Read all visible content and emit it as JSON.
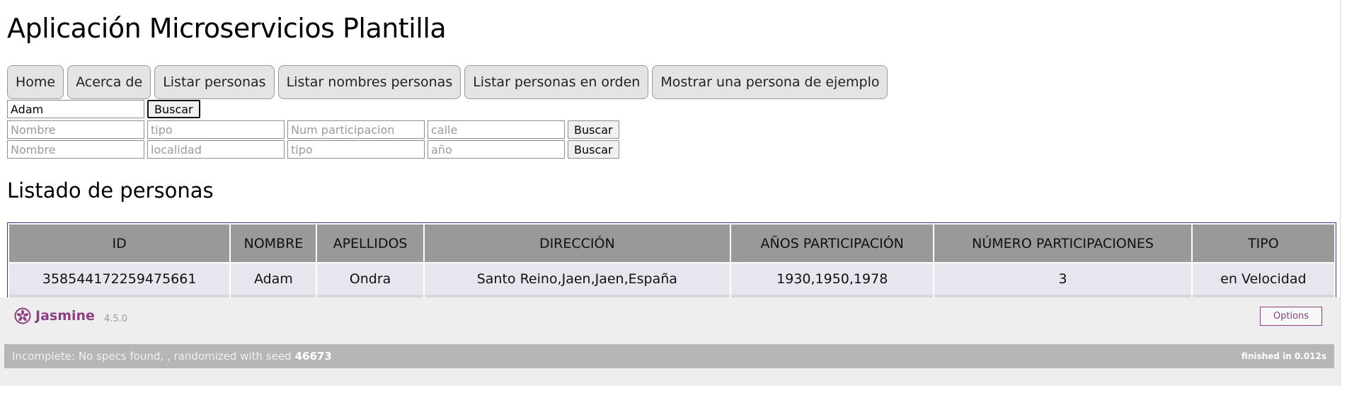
{
  "page": {
    "title": "Aplicación Microservicios Plantilla",
    "section_title": "Listado de personas"
  },
  "nav": [
    "Home",
    "Acerca de",
    "Listar personas",
    "Listar nombres personas",
    "Listar personas en orden",
    "Mostrar una persona de ejemplo"
  ],
  "search1": {
    "value": "Adam",
    "button": "Buscar"
  },
  "search2": {
    "placeholders": [
      "Nombre",
      "tipo",
      "Num participacion",
      "calle"
    ],
    "button": "Buscar"
  },
  "search3": {
    "placeholders": [
      "Nombre",
      "localidad",
      "tipo",
      "año"
    ],
    "button": "Buscar"
  },
  "table": {
    "headers": [
      "ID",
      "NOMBRE",
      "APELLIDOS",
      "DIRECCIÓN",
      "AÑOS PARTICIPACIÓN",
      "NÚMERO PARTICIPACIONES",
      "TIPO"
    ],
    "rows": [
      [
        "358544172259475661",
        "Adam",
        "Ondra",
        "Santo Reino,Jaen,Jaen,España",
        "1930,1950,1978",
        "3",
        "en Velocidad"
      ]
    ]
  },
  "jasmine": {
    "logo": "Jasmine",
    "version": "4.5.0",
    "options_label": "Options",
    "status": "Incomplete: No specs found, , randomized with seed",
    "seed": "46673",
    "finished": "finished in 0.012s",
    "accent": "#8a4182"
  }
}
